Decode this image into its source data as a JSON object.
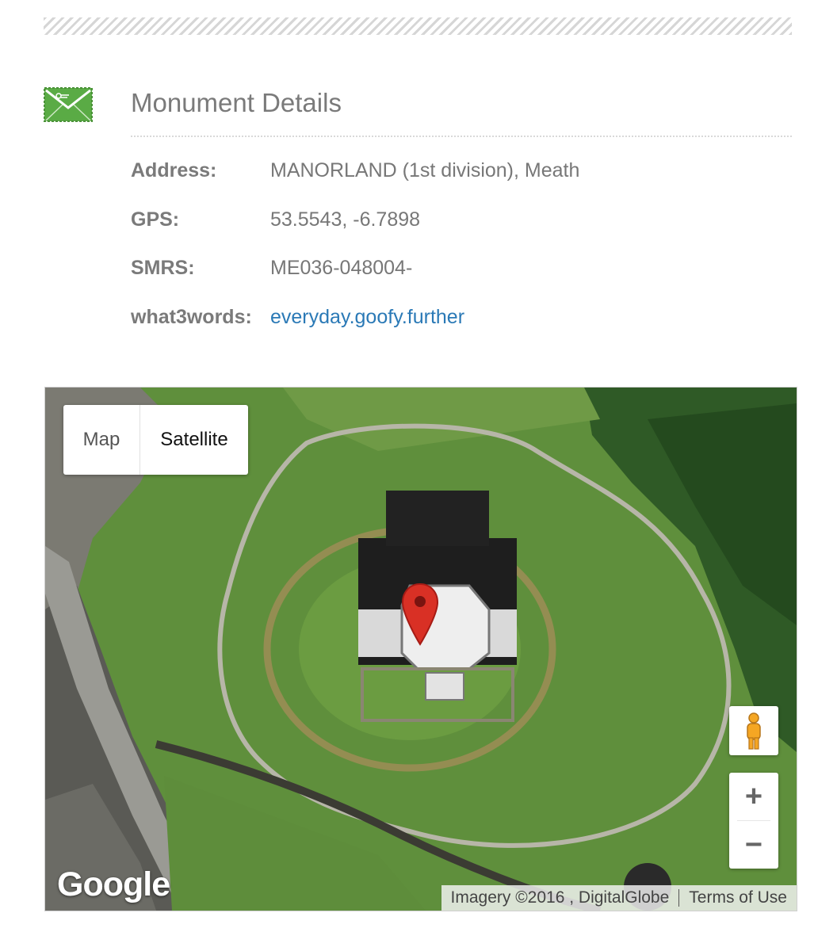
{
  "section": {
    "title": "Monument Details"
  },
  "details": [
    {
      "label": "Address:",
      "value": "MANORLAND (1st division), Meath"
    },
    {
      "label": "GPS:",
      "value": "53.5543, -6.7898"
    },
    {
      "label": "SMRS:",
      "value": "ME036-048004-"
    },
    {
      "label": "what3words:",
      "value": "everyday.goofy.further"
    }
  ],
  "map": {
    "type_control": {
      "map_label": "Map",
      "satellite_label": "Satellite",
      "selected": "Satellite"
    },
    "zoom_in_label": "+",
    "zoom_out_label": "−",
    "logo_text": "Google",
    "attribution": "Imagery ©2016 , DigitalGlobe",
    "terms_label": "Terms of Use",
    "marker_color": "#d93025",
    "pegman_color": "#f5a623"
  },
  "colors": {
    "icon_green": "#5aab45",
    "link": "#2a79b6"
  }
}
